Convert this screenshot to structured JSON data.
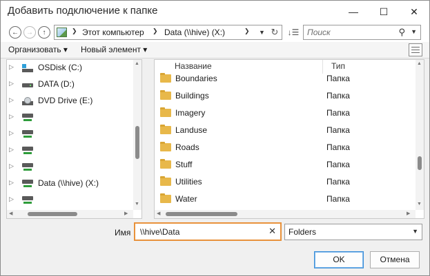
{
  "window": {
    "title": "Добавить подключение к папке",
    "minimize_glyph": "—",
    "maximize_glyph": "☐",
    "close_glyph": "✕"
  },
  "nav": {
    "back_glyph": "←",
    "forward_glyph": "→",
    "up_glyph": "↑",
    "address_segments": [
      "Этот компьютер",
      "Data (\\\\hive) (X:)"
    ],
    "dropdown_glyph": "▼",
    "refresh_glyph": "↻",
    "sort_glyph": "↓☰",
    "search_placeholder": "Поиск",
    "search_glyph": "⚲"
  },
  "commands": {
    "organize": "Организовать ▾",
    "new_item": "Новый элемент ▾"
  },
  "tree": {
    "items": [
      {
        "label": "OSDisk (C:)",
        "icon": "windows-drive-icon"
      },
      {
        "label": "DATA (D:)",
        "icon": "drive-icon"
      },
      {
        "label": "DVD Drive (E:)",
        "icon": "dvd-drive-icon"
      },
      {
        "label": "",
        "icon": "network-drive-icon"
      },
      {
        "label": "",
        "icon": "network-drive-icon"
      },
      {
        "label": "",
        "icon": "network-drive-icon"
      },
      {
        "label": "",
        "icon": "network-drive-icon"
      },
      {
        "label": "Data (\\\\hive) (X:)",
        "icon": "network-drive-icon"
      },
      {
        "label": "",
        "icon": "network-drive-icon"
      }
    ]
  },
  "list": {
    "columns": {
      "name": "Название",
      "type": "Тип"
    },
    "rows": [
      {
        "name": "Boundaries",
        "type": "Папка"
      },
      {
        "name": "Buildings",
        "type": "Папка"
      },
      {
        "name": "Imagery",
        "type": "Папка"
      },
      {
        "name": "Landuse",
        "type": "Папка"
      },
      {
        "name": "Roads",
        "type": "Папка"
      },
      {
        "name": "Stuff",
        "type": "Папка"
      },
      {
        "name": "Utilities",
        "type": "Папка"
      },
      {
        "name": "Water",
        "type": "Папка"
      }
    ]
  },
  "filename": {
    "label": "Имя",
    "value": "\\\\hive\\Data",
    "clear_glyph": "✕"
  },
  "filter": {
    "selected": "Folders"
  },
  "buttons": {
    "ok": "OK",
    "cancel": "Отмена"
  },
  "colors": {
    "focus_border": "#e8913a",
    "folder": "#e8b84a",
    "primary_border": "#3c8fd9"
  }
}
